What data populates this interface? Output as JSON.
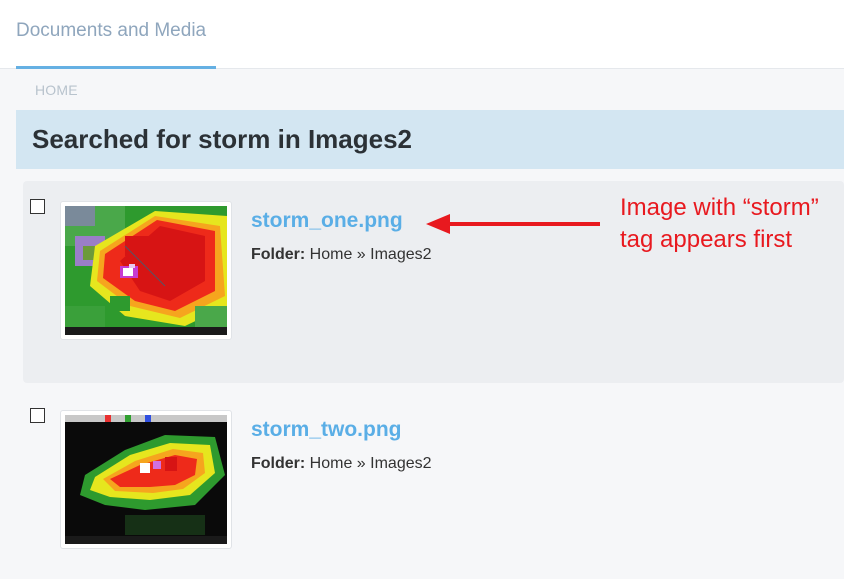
{
  "header": {
    "tab_label": "Documents and Media"
  },
  "breadcrumb": {
    "home": "HOME"
  },
  "results": {
    "title": "Searched for storm in Images2"
  },
  "entries": [
    {
      "title": "storm_one.png",
      "folder_label": "Folder:",
      "folder_path": "Home » Images2"
    },
    {
      "title": "storm_two.png",
      "folder_label": "Folder:",
      "folder_path": "Home » Images2"
    }
  ],
  "annotation": {
    "line1": "Image with “storm”",
    "line2": "tag appears first",
    "color": "#e8191f"
  },
  "colors": {
    "link": "#5aaee6",
    "header_bg": "#d3e6f2",
    "tab_underline": "#65b0e3"
  }
}
